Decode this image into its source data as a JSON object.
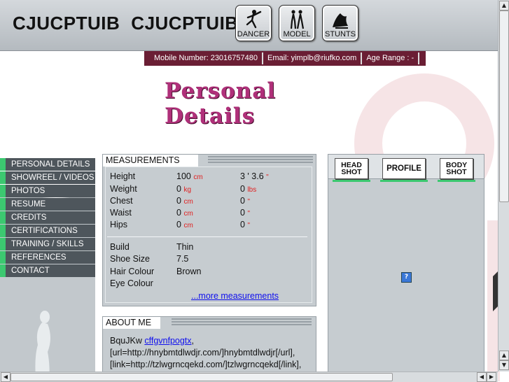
{
  "header": {
    "first_name": "CJUCPTUIB",
    "last_name": "CJUCPTUIB",
    "roles": [
      "DANCER",
      "MODEL",
      "STUNTS"
    ]
  },
  "contact_bar": {
    "mobile": "Mobile Number: 23016757480",
    "email": "Email: yimplb@riufko.com",
    "age": "Age Range : -"
  },
  "page_title": {
    "line1": "Personal",
    "line2": "Details"
  },
  "menu": {
    "items": [
      "PERSONAL DETAILS",
      "SHOWREEL / VIDEOS",
      "PHOTOS",
      "RESUME",
      "CREDITS",
      "CERTIFICATIONS",
      "TRAINING / SKILLS",
      "REFERENCES",
      "CONTACT"
    ]
  },
  "measurements": {
    "title": "MEASUREMENTS",
    "rows": [
      {
        "label": "Height",
        "metric": "100",
        "metric_unit": "cm",
        "imperial": "3 ' 3.6",
        "imperial_unit": "\""
      },
      {
        "label": "Weight",
        "metric": "0",
        "metric_unit": "kg",
        "imperial": "0",
        "imperial_unit": "lbs"
      },
      {
        "label": "Chest",
        "metric": "0",
        "metric_unit": "cm",
        "imperial": "0",
        "imperial_unit": "\""
      },
      {
        "label": "Waist",
        "metric": "0",
        "metric_unit": "cm",
        "imperial": "0",
        "imperial_unit": "\""
      },
      {
        "label": "Hips",
        "metric": "0",
        "metric_unit": "cm",
        "imperial": "0",
        "imperial_unit": "\""
      }
    ],
    "attributes": [
      {
        "label": "Build",
        "value": "Thin"
      },
      {
        "label": "Shoe Size",
        "value": "7.5"
      },
      {
        "label": "Hair Colour",
        "value": "Brown"
      },
      {
        "label": "Eye Colour",
        "value": ""
      }
    ],
    "more_link": "...more measurements"
  },
  "about": {
    "title": "ABOUT ME",
    "line1_text": "BquJKw ",
    "line1_link": "cffgvnfpogtx",
    "line1_end": ",",
    "line2": "[url=http://hnybmtdlwdjr.com/]hnybmtdlwdjr[/url],",
    "line3": "[link=http://tzlwgrncqekd.com/]tzlwgrncqekd[/link],"
  },
  "photos": {
    "buttons": [
      {
        "line1": "HEAD",
        "line2": "SHOT"
      },
      {
        "line1": "PROFILE",
        "line2": ""
      },
      {
        "line1": "BODY",
        "line2": "SHOT"
      }
    ],
    "placeholder_icon": "broken-image-icon"
  },
  "colors": {
    "menu_bg": "#4e565c",
    "menu_accent": "#3cc870",
    "contact_bar": "#6a1e34",
    "title": "#b0307a",
    "unit": "#e02020",
    "link": "#1010ee"
  }
}
